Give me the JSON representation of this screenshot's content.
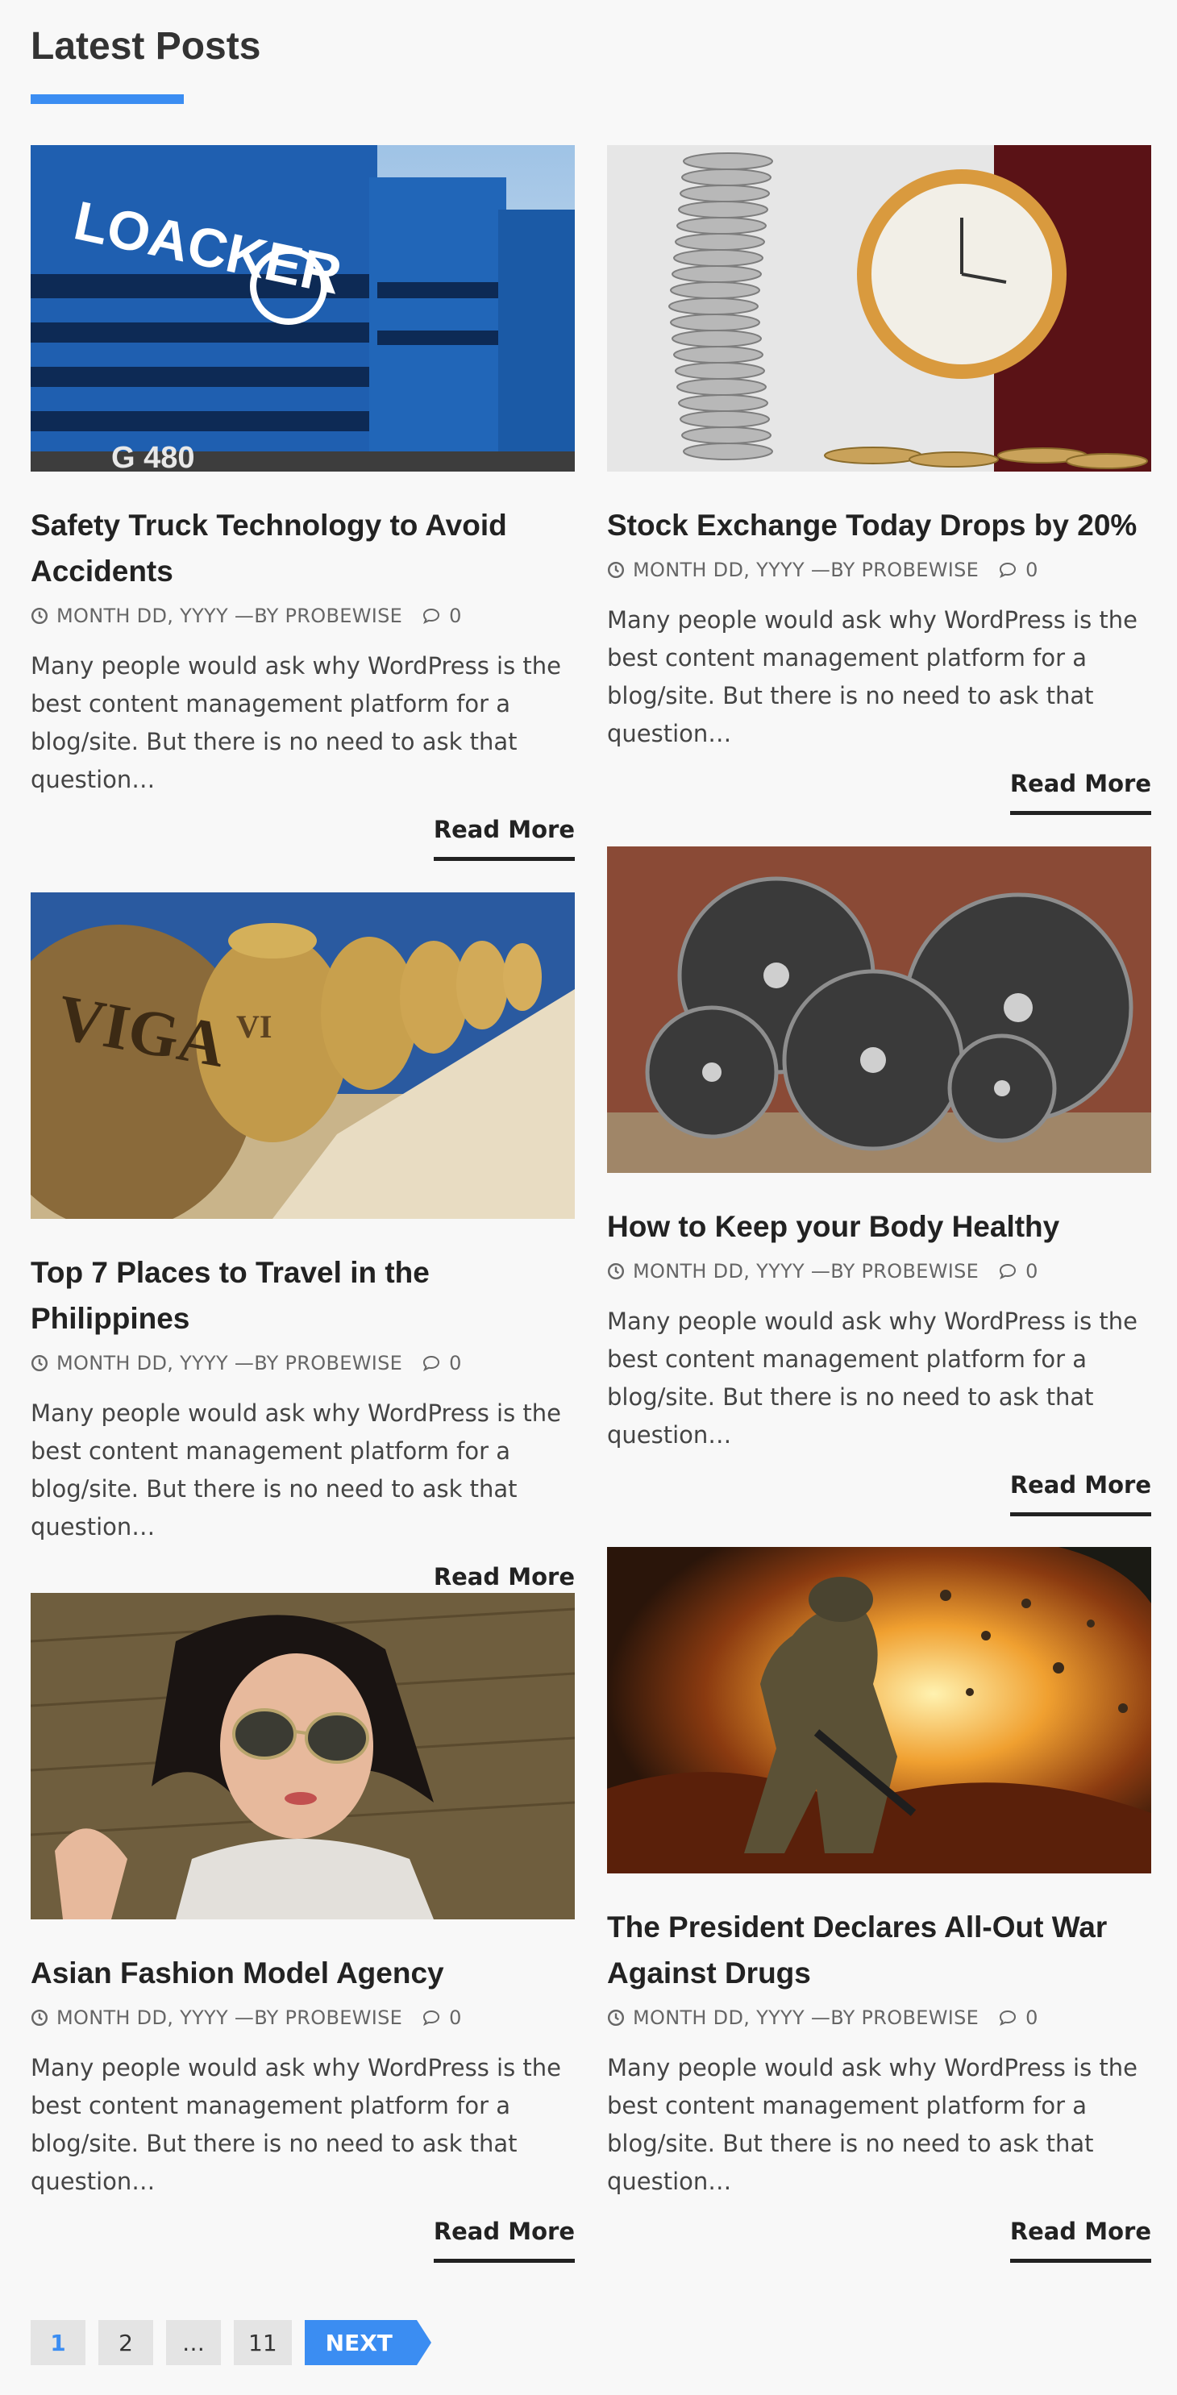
{
  "section": {
    "title": "Latest Posts",
    "accent_color": "#3b8df2"
  },
  "posts": [
    {
      "title": "Safety Truck Technology to Avoid Accidents",
      "image": "blue-trucks-photo",
      "meta_date": "MONTH DD, YYYY",
      "meta_author": "—BY PROBEWISE",
      "comments": "0",
      "excerpt": "Many people would ask why WordPress is the best content management platform for a blog/site. But there is no need to ask that question…",
      "read_more": "Read More"
    },
    {
      "title": "Stock Exchange Today Drops by 20%",
      "image": "coins-and-clock-photo",
      "meta_date": "MONTH DD, YYYY",
      "meta_author": "—BY PROBEWISE",
      "comments": "0",
      "excerpt": "Many people would ask why WordPress is the best content management platform for a blog/site. But there is no need to ask that question…",
      "read_more": "Read More"
    },
    {
      "title": "Top 7 Places to Travel in the Philippines",
      "image": "clay-jars-photo",
      "meta_date": "MONTH DD, YYYY",
      "meta_author": "—BY PROBEWISE",
      "comments": "0",
      "excerpt": "Many people would ask why WordPress is the best content management platform for a blog/site. But there is no need to ask that question…",
      "read_more": "Read More"
    },
    {
      "title": "How to Keep your Body Healthy",
      "image": "weight-plates-photo",
      "meta_date": "MONTH DD, YYYY",
      "meta_author": "—BY PROBEWISE",
      "comments": "0",
      "excerpt": "Many people would ask why WordPress is the best content management platform for a blog/site. But there is no need to ask that question…",
      "read_more": "Read More"
    },
    {
      "title": "Asian Fashion Model Agency",
      "image": "woman-sunglasses-photo",
      "meta_date": "MONTH DD, YYYY",
      "meta_author": "—BY PROBEWISE",
      "comments": "0",
      "excerpt": "Many people would ask why WordPress is the best content management platform for a blog/site. But there is no need to ask that question…",
      "read_more": "Read More"
    },
    {
      "title": "The President Declares All-Out War Against Drugs",
      "image": "soldier-explosion-photo",
      "meta_date": "MONTH DD, YYYY",
      "meta_author": "—BY PROBEWISE",
      "comments": "0",
      "excerpt": "Many people would ask why WordPress is the best content management platform for a blog/site. But there is no need to ask that question…",
      "read_more": "Read More"
    }
  ],
  "pagination": {
    "pages": [
      "1",
      "2",
      "…",
      "11"
    ],
    "current": "1",
    "next_label": "NEXT"
  }
}
